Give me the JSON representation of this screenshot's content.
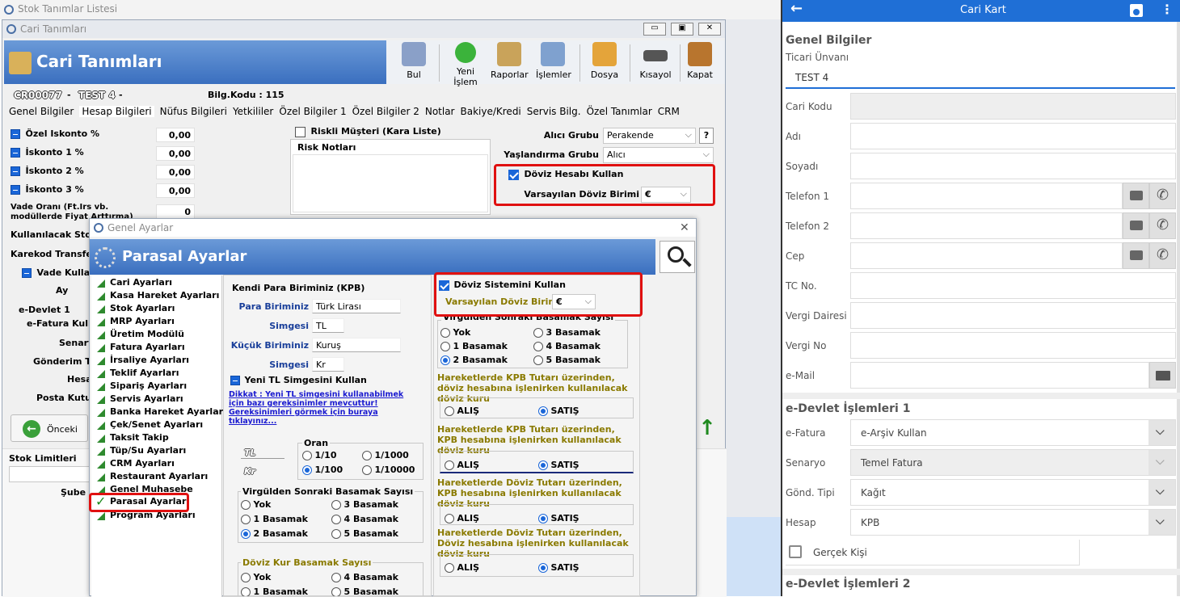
{
  "bg_window": {
    "title": "Stok Tanımlar Listesi"
  },
  "cari_window": {
    "title": "Cari Tanımları",
    "header": "Cari Tanımları",
    "toolbar": [
      "Bul",
      "Yeni İşlem",
      "Raporlar",
      "İşlemler",
      "Dosya",
      "Kısayol",
      "Kapat"
    ],
    "code": "CR00077",
    "name": "TEST 4",
    "bilg_kodu": "Bilg.Kodu : 115",
    "tabs": [
      "Genel Bilgiler",
      "Hesap Bilgileri",
      "Nüfus Bilgileri",
      "Yetkililer",
      "Özel Bilgiler 1",
      "Özel Bilgiler 2",
      "Notlar",
      "Bakiye/Kredi",
      "Servis Bilg.",
      "Özel Tanımlar",
      "CRM"
    ],
    "discounts": [
      {
        "label": "Özel Iskonto %",
        "value": "0,00"
      },
      {
        "label": "İskonto 1 %",
        "value": "0,00"
      },
      {
        "label": "İskonto 2 %",
        "value": "0,00"
      },
      {
        "label": "İskonto 3 %",
        "value": "0,00"
      }
    ],
    "vade_label": "Vade Oranı (Ft.İrs vb. modüllerde Fiyat Arttırma)",
    "vade_value": "0",
    "kullanilacak": "Kullanılacak Stok",
    "karekod": "Karekod Transfer",
    "vade_kullan": "Vade Kullan",
    "ay": "Ay",
    "edevlet": "e-Devlet 1",
    "efatura": "e-Fatura Kulla",
    "senaryo": "Senary",
    "gonderim": "Gönderim Ti",
    "hesap": "Hesa",
    "posta": "Posta Kutus",
    "onceki": "Önceki",
    "riskli": "Riskli Müşteri (Kara Liste)",
    "risk_notlari": "Risk Notları",
    "alici_grubu_label": "Alıcı Grubu",
    "alici_grubu": "Perakende",
    "help": "?",
    "yaslandirma_label": "Yaşlandırma Grubu",
    "yaslandirma": "Alıcı",
    "doviz_hesabi": "Döviz Hesabı Kullan",
    "varsayilan_label": "Varsayılan Döviz Birimi",
    "varsayilan": "€",
    "stok_limitleri": "Stok Limitleri",
    "sube": "Şube"
  },
  "genel_window": {
    "title": "Genel Ayarlar",
    "header": "Parasal Ayarlar",
    "menu": [
      "Cari Ayarları",
      "Kasa Hareket Ayarları",
      "Stok Ayarları",
      "MRP Ayarları",
      "Üretim Modülü",
      "Fatura Ayarları",
      "İrsaliye Ayarları",
      "Teklif Ayarları",
      "Sipariş Ayarları",
      "Servis Ayarları",
      "Banka Hareket Ayarları",
      "Çek/Senet Ayarları",
      "Taksit Takip",
      "Tüp/Su Ayarları",
      "CRM Ayarları",
      "Restaurant Ayarları",
      "Genel Muhasebe",
      "Parasal Ayarlar",
      "Program Ayarları"
    ],
    "kpb_title": "Kendi Para Biriminiz (KPB)",
    "para_birimi_label": "Para Biriminiz",
    "para_birimi": "Türk Lirası",
    "simgesi_label": "Simgesi",
    "simgesi": "TL",
    "kucuk_label": "Küçük Biriminiz",
    "kucuk": "Kuruş",
    "simgesi2_label": "Simgesi",
    "simgesi2": "Kr",
    "yeni_tl": "Yeni TL Simgesini Kullan",
    "dikkat": "Dikkat : Yeni TL simgesini kullanabilmek için bazı gereksinimler mevcuttur! Gereksinimleri görmek için buraya tıklayınız...",
    "tl_sample": "TL",
    "kr_sample": "Kr",
    "oran_title": "Oran",
    "oran": [
      "1/10",
      "1/1000",
      "1/100",
      "1/10000"
    ],
    "virgul_title": "Virgülden Sonraki Basamak Sayısı",
    "basamak": [
      "Yok",
      "3 Basamak",
      "1 Basamak",
      "4 Basamak",
      "2 Basamak",
      "5 Basamak"
    ],
    "doviz_kur_title": "Döviz Kur Basamak Sayısı",
    "doviz_kur": [
      "Yok",
      "4 Basamak",
      "1 Basamak",
      "5 Basamak"
    ],
    "doviz_sistemi": "Döviz Sistemini Kullan",
    "varsayilan_label": "Varsayılan Döviz Birimi",
    "varsayilan": "€",
    "virgul2_title": "Virgülden Sonraki Basamak Sayısı",
    "hareket1": "Hareketlerde KPB Tutarı üzerinden, döviz hesabına işlenirken kullanılacak döviz kuru",
    "hareket2": "Hareketlerde KPB Tutarı üzerinden, KPB hesabına işlenirken kullanılacak döviz kuru",
    "hareket3": "Hareketlerde Döviz Tutarı üzerinden, KPB hesabına işlenirken kullanılacak döviz kuru",
    "hareket4": "Hareketlerde Döviz Tutarı üzerinden, Döviz hesabına işlenirken kullanılacak döviz kuru",
    "alis": "ALIŞ",
    "satis": "SATIŞ"
  },
  "mobile": {
    "title": "Cari Kart",
    "sec1": "Genel Bilgiler",
    "ticari_label": "Ticari Ünvanı",
    "ticari": "TEST 4",
    "fields": [
      "Cari Kodu",
      "Adı",
      "Soyadı",
      "Telefon 1",
      "Telefon 2",
      "Cep",
      "TC No.",
      "Vergi Dairesi",
      "Vergi No",
      "e-Mail"
    ],
    "sec2": "e-Devlet İşlemleri 1",
    "efatura_label": "e-Fatura",
    "efatura": "e-Arşiv Kullan",
    "senaryo_label": "Senaryo",
    "senaryo": "Temel Fatura",
    "gond_label": "Gönd. Tipi",
    "gond": "Kağıt",
    "hesap_label": "Hesap",
    "hesap": "KPB",
    "gercek": "Gerçek Kişi",
    "sec3": "e-Devlet İşlemleri 2"
  }
}
